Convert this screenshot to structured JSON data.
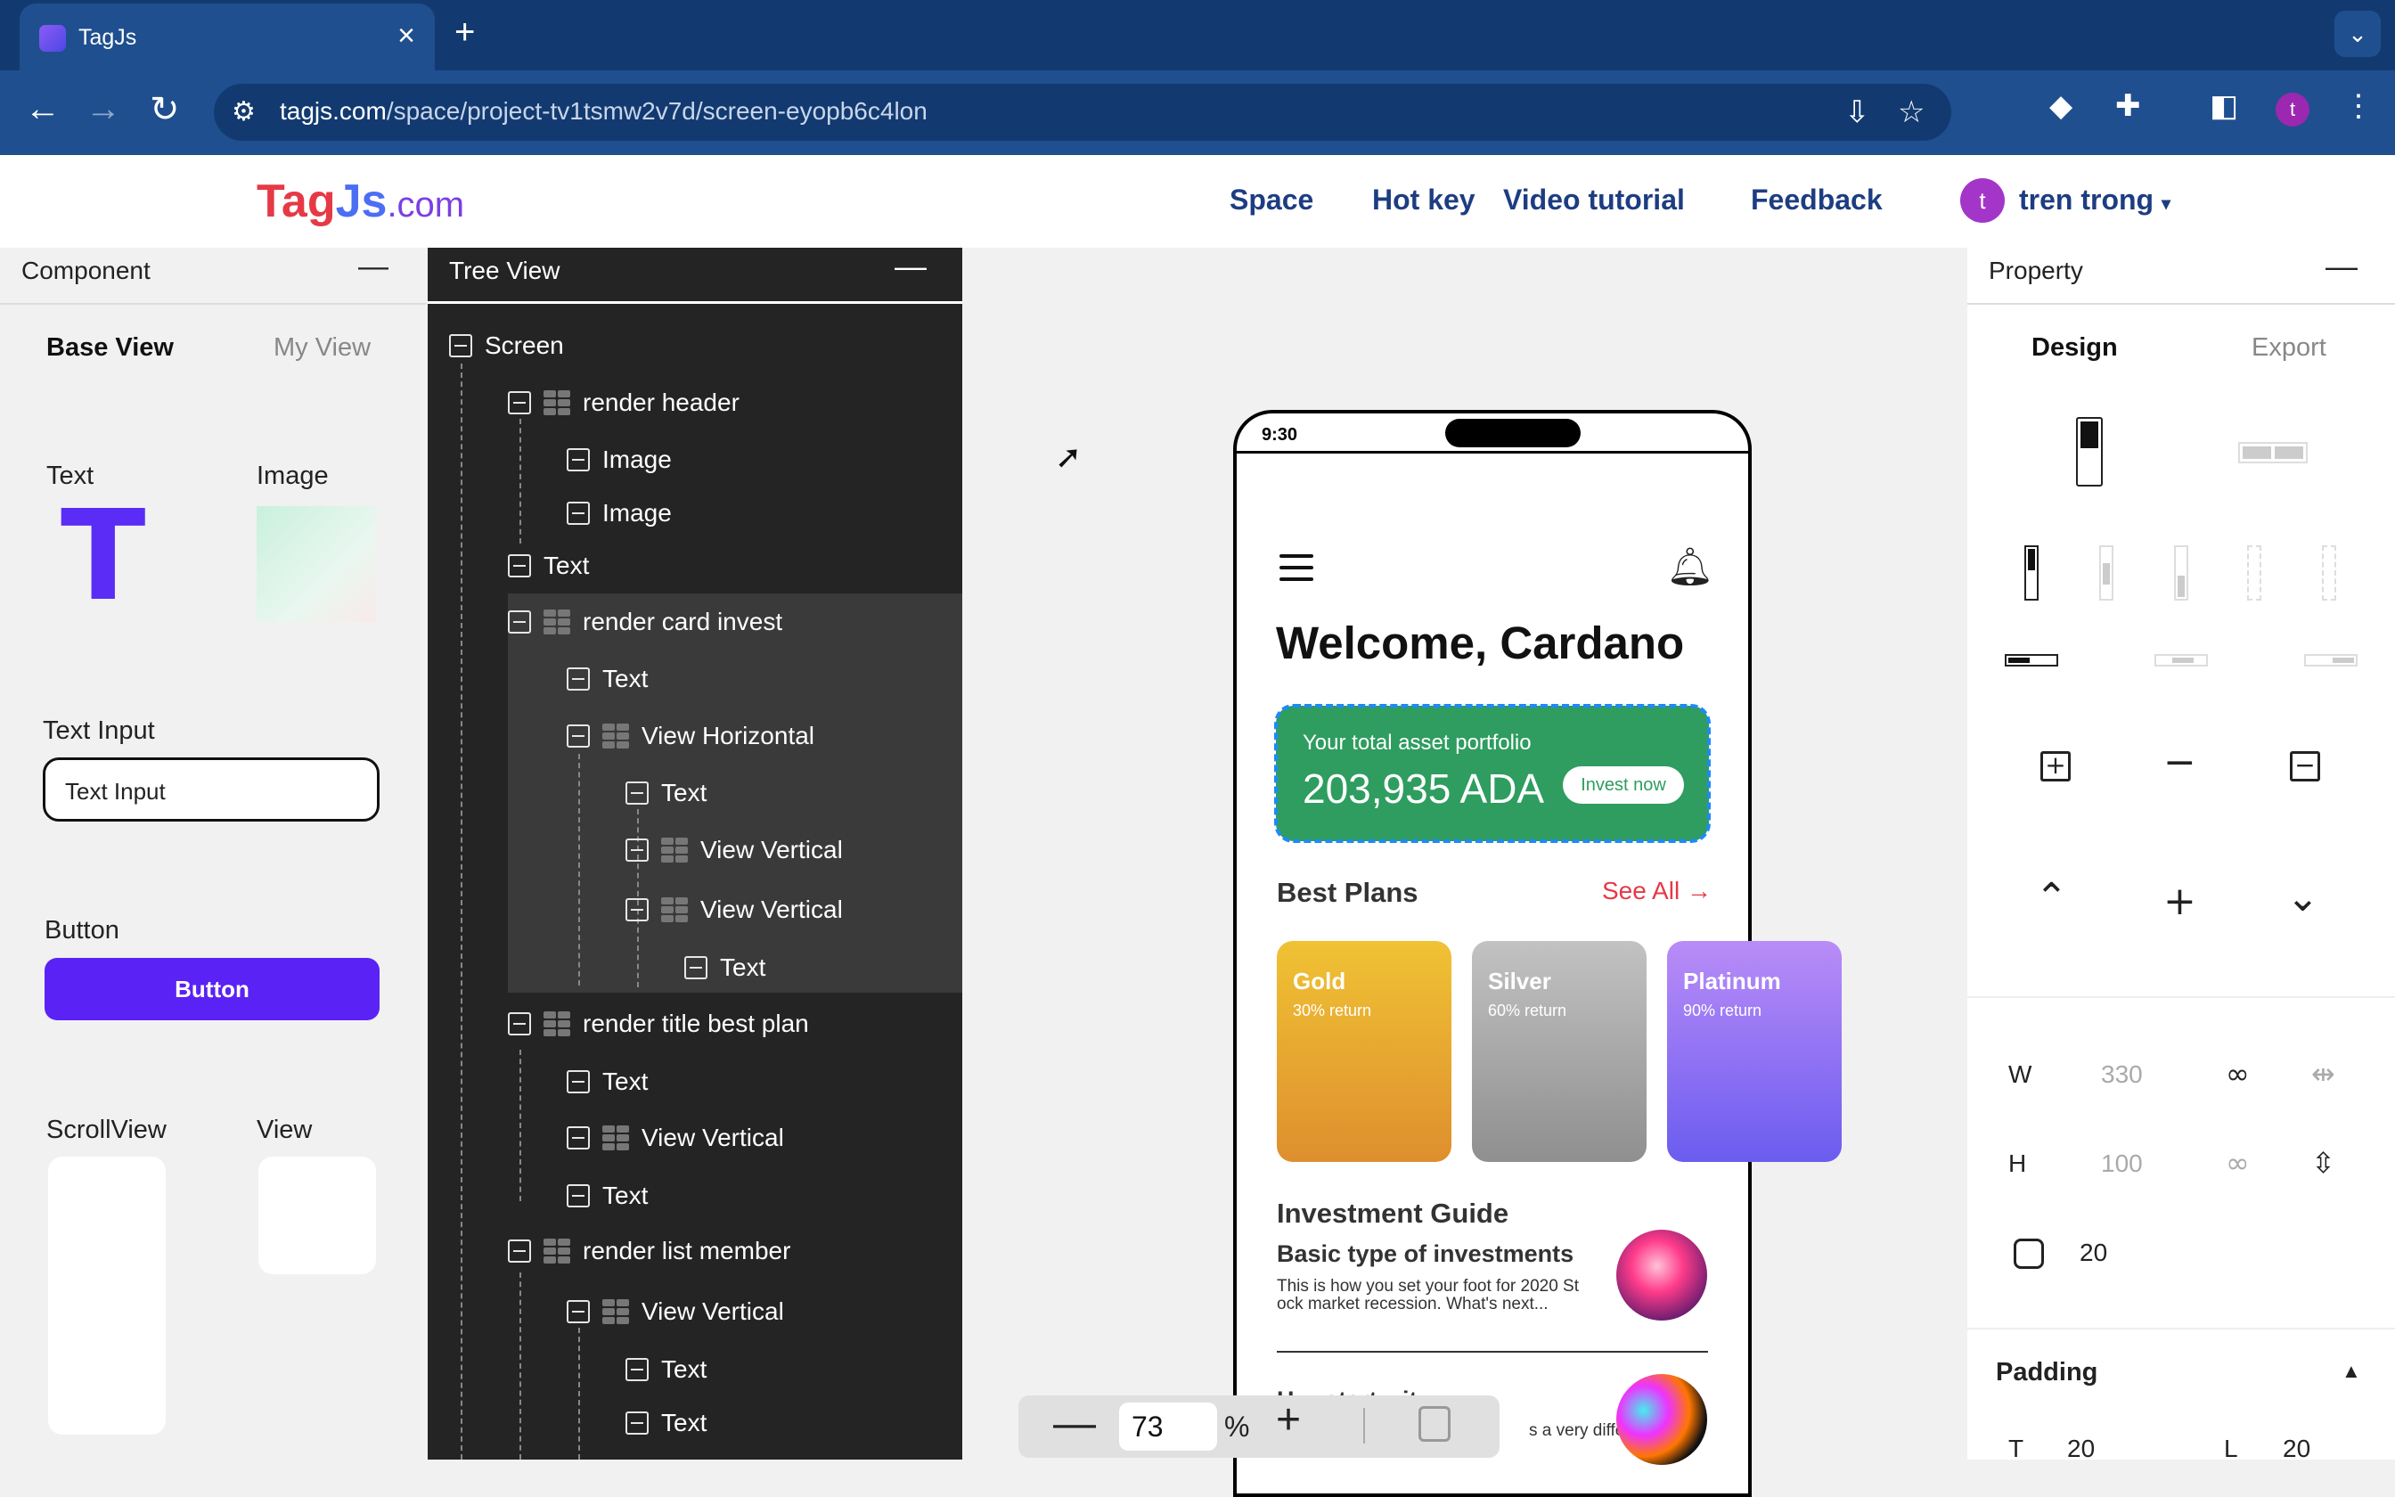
{
  "browser": {
    "tab_title": "TagJs",
    "url_host": "tagjs.com",
    "url_path": "/space/project-tv1tsmw2v7d/screen-eyopb6c4lon",
    "profile_initial": "t"
  },
  "header": {
    "logo_tag": "Tag",
    "logo_js": "Js",
    "logo_com": ".com",
    "nav": [
      "Space",
      "Hot key",
      "Video tutorial",
      "Feedback"
    ],
    "user_initial": "t",
    "user_name": "tren trong"
  },
  "component_panel": {
    "title": "Component",
    "tabs": [
      "Base View",
      "My View"
    ],
    "items": {
      "text": "Text",
      "image": "Image",
      "text_input": "Text Input",
      "text_input_value": "Text Input",
      "button": "Button",
      "button_label": "Button",
      "scrollview": "ScrollView",
      "view": "View"
    },
    "text_glyph": "T"
  },
  "tree": {
    "title": "Tree View",
    "nodes": [
      {
        "label": "Screen"
      },
      {
        "label": "render header"
      },
      {
        "label": "Image"
      },
      {
        "label": "Image"
      },
      {
        "label": "Text"
      },
      {
        "label": "render card invest"
      },
      {
        "label": "Text"
      },
      {
        "label": "View Horizontal"
      },
      {
        "label": "Text"
      },
      {
        "label": "View Vertical"
      },
      {
        "label": "View Vertical"
      },
      {
        "label": "Text"
      },
      {
        "label": "render title best plan"
      },
      {
        "label": "Text"
      },
      {
        "label": "View Vertical"
      },
      {
        "label": "Text"
      },
      {
        "label": "render list member"
      },
      {
        "label": "View Vertical"
      },
      {
        "label": "Text"
      },
      {
        "label": "Text"
      }
    ]
  },
  "phone": {
    "time": "9:30",
    "welcome": "Welcome, Cardano",
    "card_label": "Your total asset portfolio",
    "card_amount": "203,935 ADA",
    "invest_button": "Invest now",
    "best_plans": "Best Plans",
    "see_all": "See All →",
    "plans": [
      {
        "name": "Gold",
        "return": "30% return"
      },
      {
        "name": "Silver",
        "return": "60% return"
      },
      {
        "name": "Platinum",
        "return": "90% return"
      }
    ],
    "guide_title": "Investment Guide",
    "guide_sub": "Basic type of investments",
    "guide_desc": "This is how you set your foot for 2020 St ock market recession. What's next...",
    "guide2_text": "H… start wit..",
    "guide2_desc": "s a very differ way..."
  },
  "zoom": {
    "value": "73",
    "unit": "%"
  },
  "property": {
    "title": "Property",
    "tabs": [
      "Design",
      "Export"
    ],
    "w_label": "W",
    "w_value": "330",
    "h_label": "H",
    "h_value": "100",
    "radius": "20",
    "padding_label": "Padding",
    "pad_t_label": "T",
    "pad_t": "20",
    "pad_l_label": "L",
    "pad_l": "20"
  }
}
